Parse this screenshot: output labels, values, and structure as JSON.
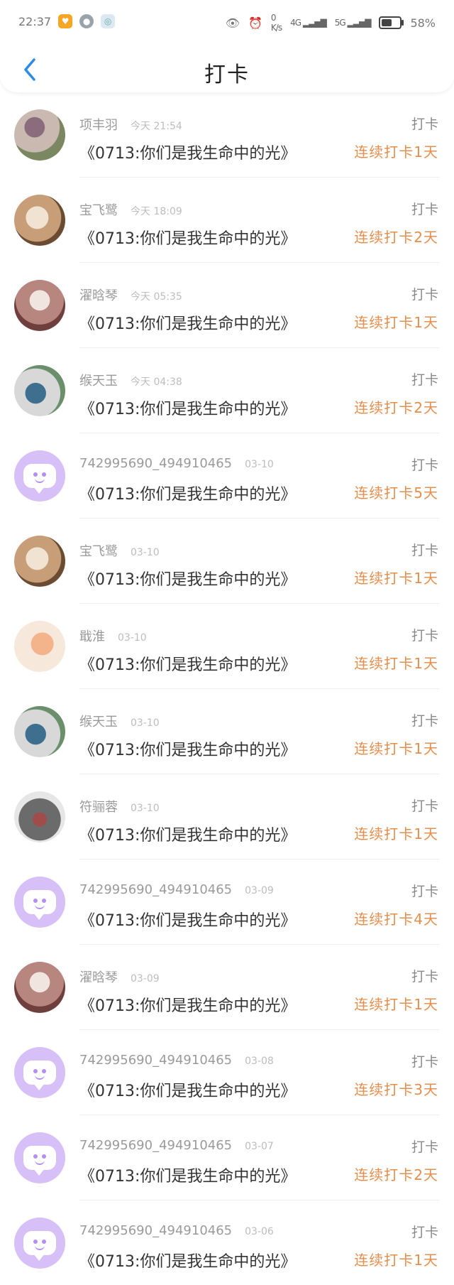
{
  "status_bar": {
    "time": "22:37",
    "speed_value": "0",
    "speed_unit": "K/s",
    "network_1": "4G",
    "network_2": "5G",
    "battery": "58%",
    "icons": [
      "eye-icon",
      "alarm-icon",
      "signal-icon",
      "signal-icon",
      "battery-icon"
    ]
  },
  "header": {
    "title": "打卡",
    "back_icon": "chevron-left-icon"
  },
  "colors": {
    "accent_orange": "#e58e4c",
    "avatar_purple": "#d7bff7",
    "back_blue": "#2b8be6"
  },
  "items": [
    {
      "avatar": "photo-1",
      "name": "项丰羽",
      "time": "今天 21:54",
      "message": "《0713:你们是我生命中的光》",
      "tag": "打卡",
      "streak": "连续打卡1天"
    },
    {
      "avatar": "photo-2",
      "name": "宝飞鹭",
      "time": "今天 18:09",
      "message": "《0713:你们是我生命中的光》",
      "tag": "打卡",
      "streak": "连续打卡2天"
    },
    {
      "avatar": "photo-3",
      "name": "濯晗琴",
      "time": "今天 05:35",
      "message": "《0713:你们是我生命中的光》",
      "tag": "打卡",
      "streak": "连续打卡1天"
    },
    {
      "avatar": "photo-4",
      "name": "缑天玉",
      "time": "今天 04:38",
      "message": "《0713:你们是我生命中的光》",
      "tag": "打卡",
      "streak": "连续打卡2天"
    },
    {
      "avatar": "bubble",
      "name": "742995690_494910465",
      "time": "03-10",
      "message": "《0713:你们是我生命中的光》",
      "tag": "打卡",
      "streak": "连续打卡5天"
    },
    {
      "avatar": "photo-2",
      "name": "宝飞鹭",
      "time": "03-10",
      "message": "《0713:你们是我生命中的光》",
      "tag": "打卡",
      "streak": "连续打卡1天"
    },
    {
      "avatar": "photo-5",
      "name": "戢淮",
      "time": "03-10",
      "message": "《0713:你们是我生命中的光》",
      "tag": "打卡",
      "streak": "连续打卡1天"
    },
    {
      "avatar": "photo-4",
      "name": "缑天玉",
      "time": "03-10",
      "message": "《0713:你们是我生命中的光》",
      "tag": "打卡",
      "streak": "连续打卡1天"
    },
    {
      "avatar": "photo-6",
      "name": "符骊蓉",
      "time": "03-10",
      "message": "《0713:你们是我生命中的光》",
      "tag": "打卡",
      "streak": "连续打卡1天"
    },
    {
      "avatar": "bubble",
      "name": "742995690_494910465",
      "time": "03-09",
      "message": "《0713:你们是我生命中的光》",
      "tag": "打卡",
      "streak": "连续打卡4天"
    },
    {
      "avatar": "photo-3",
      "name": "濯晗琴",
      "time": "03-09",
      "message": "《0713:你们是我生命中的光》",
      "tag": "打卡",
      "streak": "连续打卡1天"
    },
    {
      "avatar": "bubble",
      "name": "742995690_494910465",
      "time": "03-08",
      "message": "《0713:你们是我生命中的光》",
      "tag": "打卡",
      "streak": "连续打卡3天"
    },
    {
      "avatar": "bubble",
      "name": "742995690_494910465",
      "time": "03-07",
      "message": "《0713:你们是我生命中的光》",
      "tag": "打卡",
      "streak": "连续打卡2天"
    },
    {
      "avatar": "bubble",
      "name": "742995690_494910465",
      "time": "03-06",
      "message": "《0713:你们是我生命中的光》",
      "tag": "打卡",
      "streak": "连续打卡1天"
    }
  ]
}
